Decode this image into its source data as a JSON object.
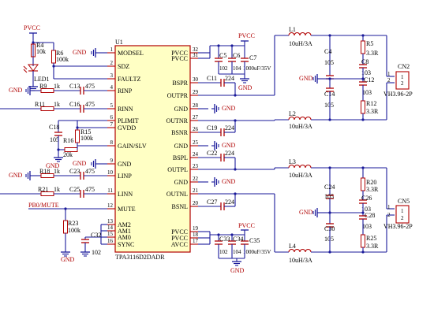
{
  "ic": {
    "ref": "U1",
    "part": "TPA3116D2DADR",
    "left_pins": [
      {
        "num": "1",
        "name": "MODSEL"
      },
      {
        "num": "2",
        "name": "SDZ"
      },
      {
        "num": "3",
        "name": "FAULTZ"
      },
      {
        "num": "4",
        "name": "RINP"
      },
      {
        "num": "5",
        "name": "RINN"
      },
      {
        "num": "6",
        "name": "PLIMIT"
      },
      {
        "num": "7",
        "name": "GVDD"
      },
      {
        "num": "8",
        "name": "GAIN/SLV"
      },
      {
        "num": "9",
        "name": "GND"
      },
      {
        "num": "10",
        "name": "LINP"
      },
      {
        "num": "11",
        "name": "LINN"
      },
      {
        "num": "12",
        "name": "MUTE"
      },
      {
        "num": "13",
        "name": "AM2"
      },
      {
        "num": "14",
        "name": "AM1"
      },
      {
        "num": "15",
        "name": "AM0"
      },
      {
        "num": "16",
        "name": "SYNC"
      }
    ],
    "right_pins": [
      {
        "num": "32",
        "name": "PVCC"
      },
      {
        "num": "31",
        "name": "PVCC"
      },
      {
        "num": "30",
        "name": "BSPR"
      },
      {
        "num": "29",
        "name": "OUTPR"
      },
      {
        "num": "28",
        "name": "GND"
      },
      {
        "num": "27",
        "name": "OUTNR"
      },
      {
        "num": "26",
        "name": "BSNR"
      },
      {
        "num": "25",
        "name": "GND"
      },
      {
        "num": "24",
        "name": "BSPL"
      },
      {
        "num": "23",
        "name": "OUTPL"
      },
      {
        "num": "22",
        "name": "GND"
      },
      {
        "num": "21",
        "name": "OUTNL"
      },
      {
        "num": "20",
        "name": "BSNL"
      },
      {
        "num": "19",
        "name": "PVCC"
      },
      {
        "num": "18",
        "name": "PVCC"
      },
      {
        "num": "17",
        "name": "AVCC"
      }
    ]
  },
  "nets": {
    "pvcc": "PVCC",
    "gnd": "GND",
    "mute_net": "PB0/MUTE"
  },
  "components": {
    "r4": {
      "ref": "R4",
      "value": "10k"
    },
    "r6": {
      "ref": "R6",
      "value": "100k"
    },
    "led1": {
      "ref": "LED1"
    },
    "r9": {
      "ref": "R9",
      "value": "1k"
    },
    "c13": {
      "ref": "C13",
      "value": "475"
    },
    "r11": {
      "ref": "R11",
      "value": "1k"
    },
    "c16": {
      "ref": "C16",
      "value": "475"
    },
    "c18": {
      "ref": "C18",
      "value": "105"
    },
    "r15": {
      "ref": "R15",
      "value": "100k"
    },
    "r16": {
      "ref": "R16",
      "value": "20k"
    },
    "r18": {
      "ref": "R18",
      "value": "1k"
    },
    "c23": {
      "ref": "C23",
      "value": "475"
    },
    "r21": {
      "ref": "R21",
      "value": "1k"
    },
    "c25": {
      "ref": "C25",
      "value": "475"
    },
    "r23": {
      "ref": "R23",
      "value": "100k"
    },
    "c32": {
      "ref": "C32",
      "value": "102"
    },
    "c5": {
      "ref": "C5",
      "value": "102"
    },
    "c6": {
      "ref": "C6",
      "value": "104"
    },
    "c7": {
      "ref": "C7",
      "value": "1000uF/35V"
    },
    "c11": {
      "ref": "C11",
      "value": "224"
    },
    "c19": {
      "ref": "C19",
      "value": "224"
    },
    "c22": {
      "ref": "C22",
      "value": "224"
    },
    "c27": {
      "ref": "C27",
      "value": "224"
    },
    "c33": {
      "ref": "C33",
      "value": "102"
    },
    "c34": {
      "ref": "C34",
      "value": "104"
    },
    "c35": {
      "ref": "C35",
      "value": "1000uF/35V"
    },
    "l1": {
      "ref": "L1",
      "value": "10uH/3A"
    },
    "l2": {
      "ref": "L2",
      "value": "10uH/3A"
    },
    "l3": {
      "ref": "L3",
      "value": "10uH/3A"
    },
    "l4": {
      "ref": "L4",
      "value": "10uH/3A"
    },
    "c4": {
      "ref": "C4",
      "value": "105"
    },
    "c8": {
      "ref": "C8",
      "value": "103"
    },
    "c12": {
      "ref": "C12",
      "value": "103"
    },
    "c14": {
      "ref": "C14",
      "value": "105"
    },
    "r5": {
      "ref": "R5",
      "value": "3.3R"
    },
    "r12": {
      "ref": "R12",
      "value": "3.3R"
    },
    "c24": {
      "ref": "C24",
      "value": "105"
    },
    "c26": {
      "ref": "C26",
      "value": "103"
    },
    "c28": {
      "ref": "C28",
      "value": "103"
    },
    "c30": {
      "ref": "C30",
      "value": "105"
    },
    "r20": {
      "ref": "R20",
      "value": "3.3R"
    },
    "r25": {
      "ref": "R25",
      "value": "3.3R"
    }
  },
  "connectors": [
    {
      "ref": "CN2",
      "part": "VH3.96-2P",
      "pins": [
        "1",
        "2"
      ]
    },
    {
      "ref": "CN5",
      "part": "VH3.96-2P",
      "pins": [
        "1",
        "2"
      ]
    }
  ]
}
